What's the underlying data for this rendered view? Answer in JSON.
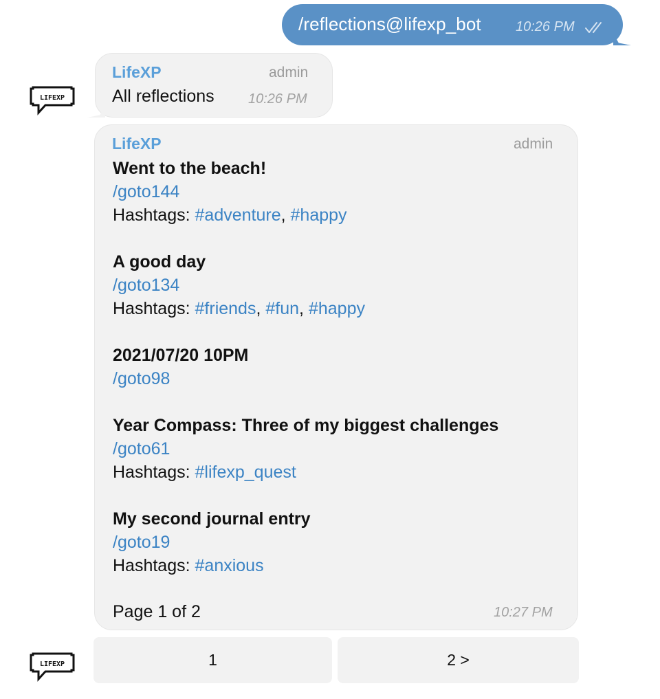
{
  "outgoing": {
    "text": "/reflections@lifexp_bot",
    "time": "10:26 PM"
  },
  "first_message": {
    "sender": "LifeXP",
    "role": "admin",
    "text": "All reflections",
    "time": "10:26 PM"
  },
  "list_message": {
    "sender": "LifeXP",
    "role": "admin",
    "hashtags_label": "Hashtags: ",
    "separator": ", ",
    "entries": [
      {
        "title": "Went to the beach!",
        "command": "/goto144",
        "hashtags": [
          "#adventure",
          "#happy"
        ]
      },
      {
        "title": "A good day",
        "command": "/goto134",
        "hashtags": [
          "#friends",
          "#fun",
          "#happy"
        ]
      },
      {
        "title": "2021/07/20 10PM",
        "command": "/goto98",
        "hashtags": []
      },
      {
        "title": "Year Compass: Three of my biggest challenges",
        "command": "/goto61",
        "hashtags": [
          "#lifexp_quest"
        ]
      },
      {
        "title": "My second journal entry",
        "command": "/goto19",
        "hashtags": [
          "#anxious"
        ]
      }
    ],
    "footer": "Page 1 of 2",
    "time": "10:27 PM"
  },
  "keyboard": {
    "buttons": [
      "1",
      "2 >"
    ]
  },
  "avatar": {
    "label": "LIFEXP",
    "icon": "speech-bubble-logo-icon"
  }
}
